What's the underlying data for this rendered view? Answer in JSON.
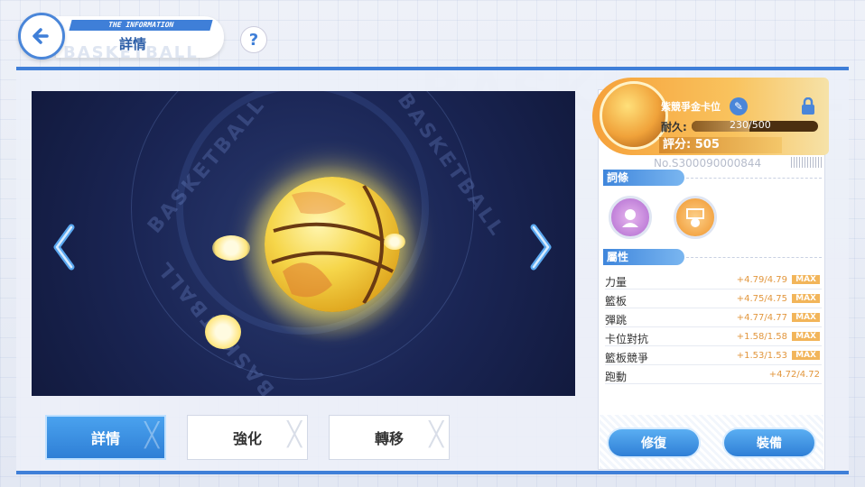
{
  "header": {
    "tag": "THE INFORMATION",
    "title": "詳情",
    "watermark": "BASKETBALL",
    "help_label": "?"
  },
  "viewer": {
    "text_top": "BASKETBALL",
    "text_right": "BASKETBALL",
    "text_left": "BASKETBALL"
  },
  "tabs": [
    {
      "label": "詳情",
      "active": true
    },
    {
      "label": "強化",
      "active": false
    },
    {
      "label": "轉移",
      "active": false
    }
  ],
  "card": {
    "name": "紫競爭金卡位",
    "durability_label": "耐久:",
    "durability_text": "230/500",
    "durability_fraction": 0.46,
    "score_label": "評分: 505",
    "serial": "No.S300090000844"
  },
  "sections": {
    "affix_title": "詞條",
    "attr_title": "屬性"
  },
  "stats": [
    {
      "name": "力量",
      "value": "+4.79/4.79",
      "max": "MAX"
    },
    {
      "name": "籃板",
      "value": "+4.75/4.75",
      "max": "MAX"
    },
    {
      "name": "彈跳",
      "value": "+4.77/4.77",
      "max": "MAX"
    },
    {
      "name": "卡位對抗",
      "value": "+1.58/1.58",
      "max": "MAX"
    },
    {
      "name": "籃板競爭",
      "value": "+1.53/1.53",
      "max": "MAX"
    },
    {
      "name": "跑動",
      "value": "+4.72/4.72",
      "max": ""
    }
  ],
  "actions": {
    "repair": "修復",
    "equip": "裝備"
  },
  "colors": {
    "accent": "#3f7fd8",
    "gold": "#f6a13a",
    "stat_value": "#e2963c"
  }
}
